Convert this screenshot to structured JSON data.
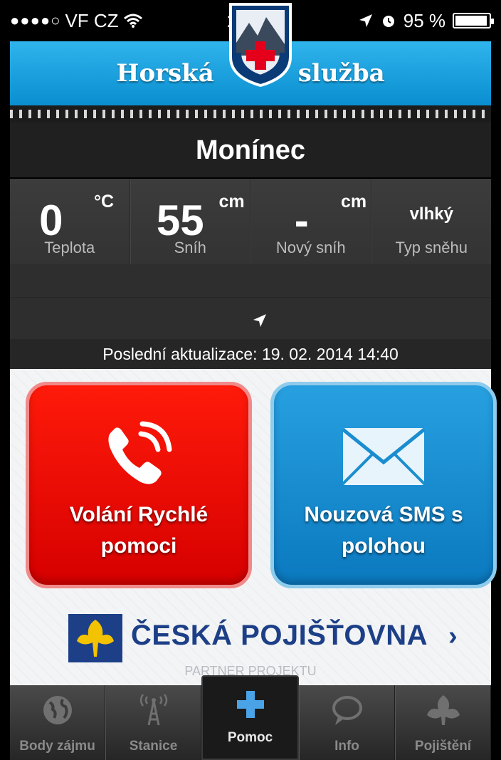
{
  "status_bar": {
    "carrier": "VF CZ",
    "signal": "●●●●○",
    "time": "14:47",
    "battery": "95 %",
    "battery_level": 0.95
  },
  "header": {
    "brand_left": "Horská",
    "brand_right": "služba",
    "logo_text": "HORSKÁ SLUŽBA"
  },
  "location": {
    "name": "Monínec"
  },
  "stats": [
    {
      "value": "0",
      "unit": "°C",
      "label": "Teplota"
    },
    {
      "value": "55",
      "unit": "cm",
      "label": "Sníh"
    },
    {
      "value": "-",
      "unit": "cm",
      "label": "Nový sníh"
    },
    {
      "value": "vlhký",
      "unit": "",
      "label": "Typ sněhu"
    }
  ],
  "update": {
    "text": "Poslední aktualizace: 19. 02. 2014 14:40"
  },
  "actions": {
    "call_label_line1": "Volání Rychlé",
    "call_label_line2": "pomoci",
    "sms_label_line1": "Nouzová SMS s",
    "sms_label_line2": "polohou",
    "call_color": "#e60000",
    "sms_color": "#1a8dd0"
  },
  "partner": {
    "name": "ČESKÁ POJIŠŤOVNA",
    "chevron": "›",
    "subtitle": "PARTNER PROJEKTU",
    "color": "#1c3f87"
  },
  "tabs": [
    {
      "label": "Body zájmu",
      "icon": "globe-icon"
    },
    {
      "label": "Stanice",
      "icon": "antenna-icon"
    },
    {
      "label": "Pomoc",
      "icon": "plus-icon",
      "active": true
    },
    {
      "label": "Info",
      "icon": "speech-bubble-icon"
    },
    {
      "label": "Pojištění",
      "icon": "leaf-icon"
    }
  ]
}
